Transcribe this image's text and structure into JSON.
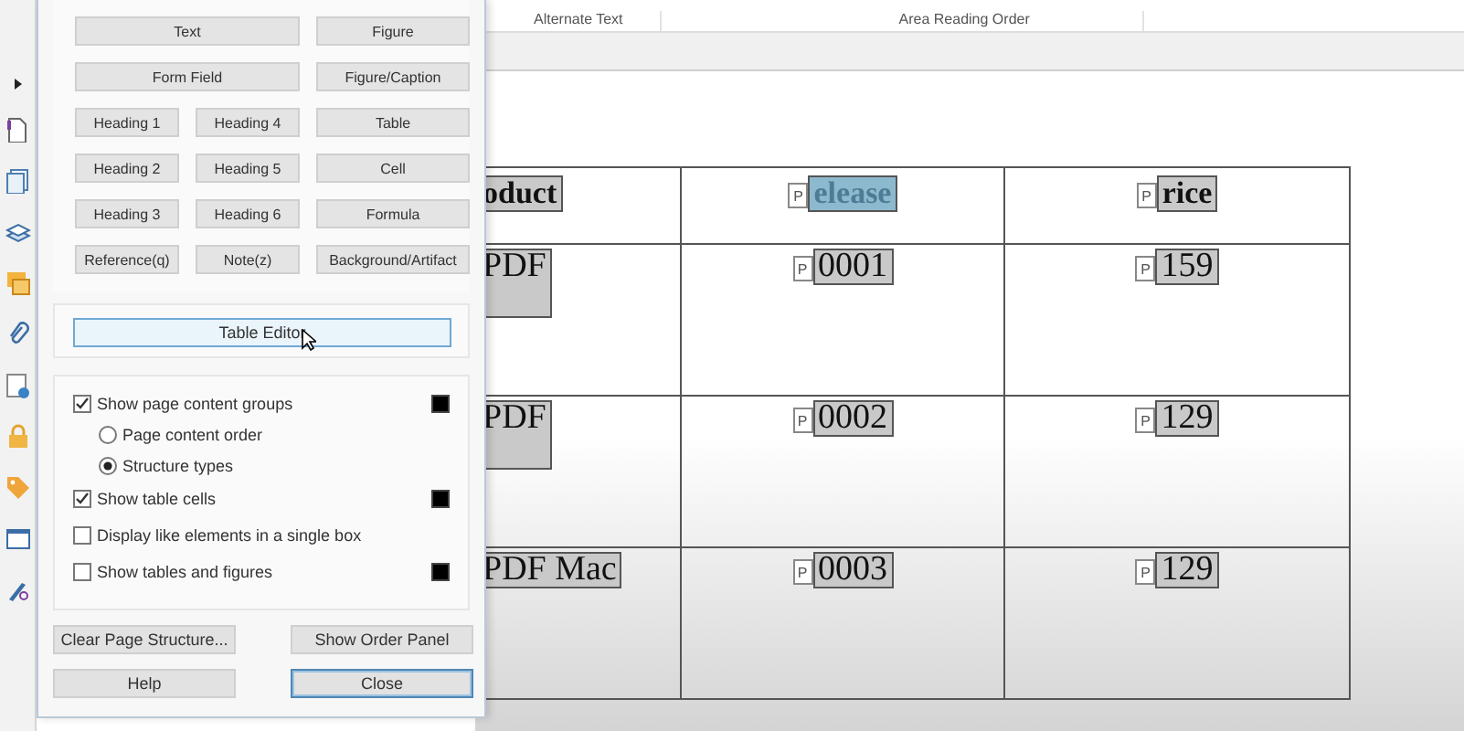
{
  "ribbon": {
    "groups": [
      "Alternate Text",
      "Area Reading Order"
    ]
  },
  "dialog": {
    "tag_buttons": [
      {
        "label": "Text",
        "wide": true
      },
      {
        "label": "Figure",
        "wide": false
      },
      {
        "label": "Form Field",
        "wide": true
      },
      {
        "label": "Figure/Caption",
        "wide": false
      },
      {
        "label": "Heading 1",
        "wide": false
      },
      {
        "label": "Heading 4",
        "wide": false
      },
      {
        "label": "Table",
        "wide": false
      },
      {
        "label": "Heading 2",
        "wide": false
      },
      {
        "label": "Heading 5",
        "wide": false
      },
      {
        "label": "Cell",
        "wide": false
      },
      {
        "label": "Heading 3",
        "wide": false
      },
      {
        "label": "Heading 6",
        "wide": false
      },
      {
        "label": "Formula",
        "wide": false
      },
      {
        "label": "Reference(q)",
        "wide": false
      },
      {
        "label": "Note(z)",
        "wide": false
      },
      {
        "label": "Background/Artifact",
        "wide": false
      }
    ],
    "table_editor": {
      "label": "Table Editor",
      "hovered": true
    },
    "options": [
      {
        "kind": "checkbox",
        "label": "Show page content groups",
        "checked": true,
        "swatch": true
      },
      {
        "kind": "radio",
        "label": "Page content order",
        "selected": false
      },
      {
        "kind": "radio",
        "label": "Structure types",
        "selected": true
      },
      {
        "kind": "checkbox",
        "label": "Show table cells",
        "checked": true,
        "swatch": true
      },
      {
        "kind": "checkbox",
        "label": "Display like elements in a single box",
        "checked": false,
        "swatch": false
      },
      {
        "kind": "checkbox",
        "label": "Show tables and figures",
        "checked": false,
        "swatch": true
      }
    ],
    "actions": [
      {
        "label": "Clear Page Structure...",
        "focused": false
      },
      {
        "label": "Show Order Panel",
        "focused": false
      },
      {
        "label": "Help",
        "focused": false
      },
      {
        "label": "Close",
        "focused": true
      }
    ]
  },
  "table": {
    "header": [
      {
        "text": "oduct",
        "selected": false
      },
      {
        "text": "elease",
        "tag": "P",
        "selected": true
      },
      {
        "text": "rice",
        "tag": "P",
        "selected": false
      }
    ],
    "rows": [
      [
        {
          "text": "PDF"
        },
        {
          "text": "0001",
          "tag": "P"
        },
        {
          "text": "159",
          "tag": "P"
        }
      ],
      [
        {
          "text": "PDF"
        },
        {
          "text": "0002",
          "tag": "P"
        },
        {
          "text": "129",
          "tag": "P"
        }
      ],
      [
        {
          "text": "PDF Mac"
        },
        {
          "text": "0003",
          "tag": "P"
        },
        {
          "text": "129",
          "tag": "P"
        }
      ]
    ]
  }
}
